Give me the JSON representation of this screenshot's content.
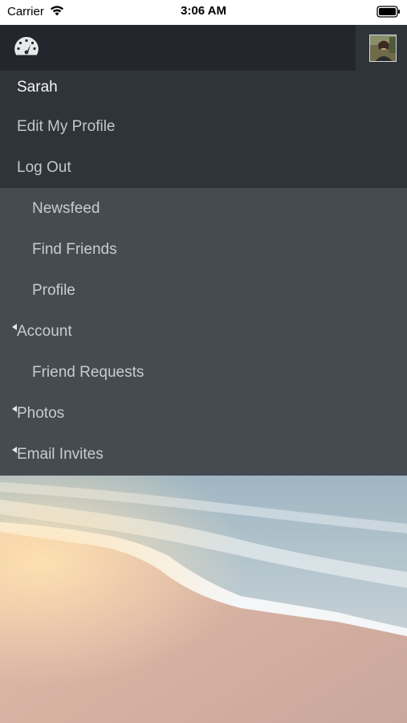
{
  "status_bar": {
    "carrier": "Carrier",
    "time": "3:06 AM",
    "icons": [
      "wifi-icon",
      "battery-icon"
    ]
  },
  "nav": {
    "left_icon": "dashboard-gauge-icon",
    "avatar": "user-avatar-photo"
  },
  "account_menu": {
    "username": "Sarah",
    "edit_profile": "Edit My Profile",
    "log_out": "Log Out"
  },
  "menu": {
    "items": [
      {
        "label": "Newsfeed",
        "level": "child",
        "expandable": false
      },
      {
        "label": "Find Friends",
        "level": "child",
        "expandable": false
      },
      {
        "label": "Profile",
        "level": "child",
        "expandable": false
      },
      {
        "label": "Account",
        "level": "parent",
        "expandable": true
      },
      {
        "label": "Friend Requests",
        "level": "child",
        "expandable": false
      },
      {
        "label": "Photos",
        "level": "parent",
        "expandable": true
      },
      {
        "label": "Email Invites",
        "level": "parent",
        "expandable": true
      }
    ]
  },
  "colors": {
    "nav_dark": "#23272d",
    "account_bg": "#2f343b",
    "menu_bg": "#464b52",
    "menu_text": "#c8ccd0"
  },
  "background_image": "beach-shoreline-waves"
}
